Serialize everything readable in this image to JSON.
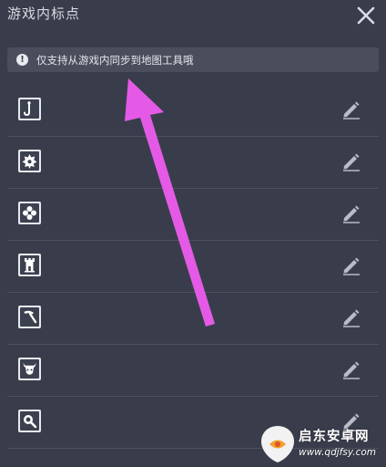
{
  "header": {
    "title": "游戏内标点",
    "close_icon": "close-icon"
  },
  "notice": {
    "icon": "exclamation-icon",
    "icon_glyph": "!",
    "text": "仅支持从游戏内同步到地图工具哦"
  },
  "markers": [
    {
      "icon": "fishing-hook-icon",
      "action_icon": "pencil-icon"
    },
    {
      "icon": "star-gear-icon",
      "action_icon": "pencil-icon"
    },
    {
      "icon": "flower-icon",
      "action_icon": "pencil-icon"
    },
    {
      "icon": "tower-icon",
      "action_icon": "pencil-icon"
    },
    {
      "icon": "pickaxe-icon",
      "action_icon": "pencil-icon"
    },
    {
      "icon": "bull-head-icon",
      "action_icon": "pencil-icon"
    },
    {
      "icon": "magnifier-icon",
      "action_icon": "pencil-icon"
    }
  ],
  "overlay": {
    "annotation": "pink-arrow-annotation",
    "arrow_color": "#e45ae6"
  },
  "watermark": {
    "brand": "启东安卓网",
    "url": "www.qdjfsy.com"
  },
  "colors": {
    "background": "#393d4b",
    "notice_bg": "#4a4e5c",
    "divider": "#4d5160",
    "icon_frame": "#e7e9ee"
  }
}
